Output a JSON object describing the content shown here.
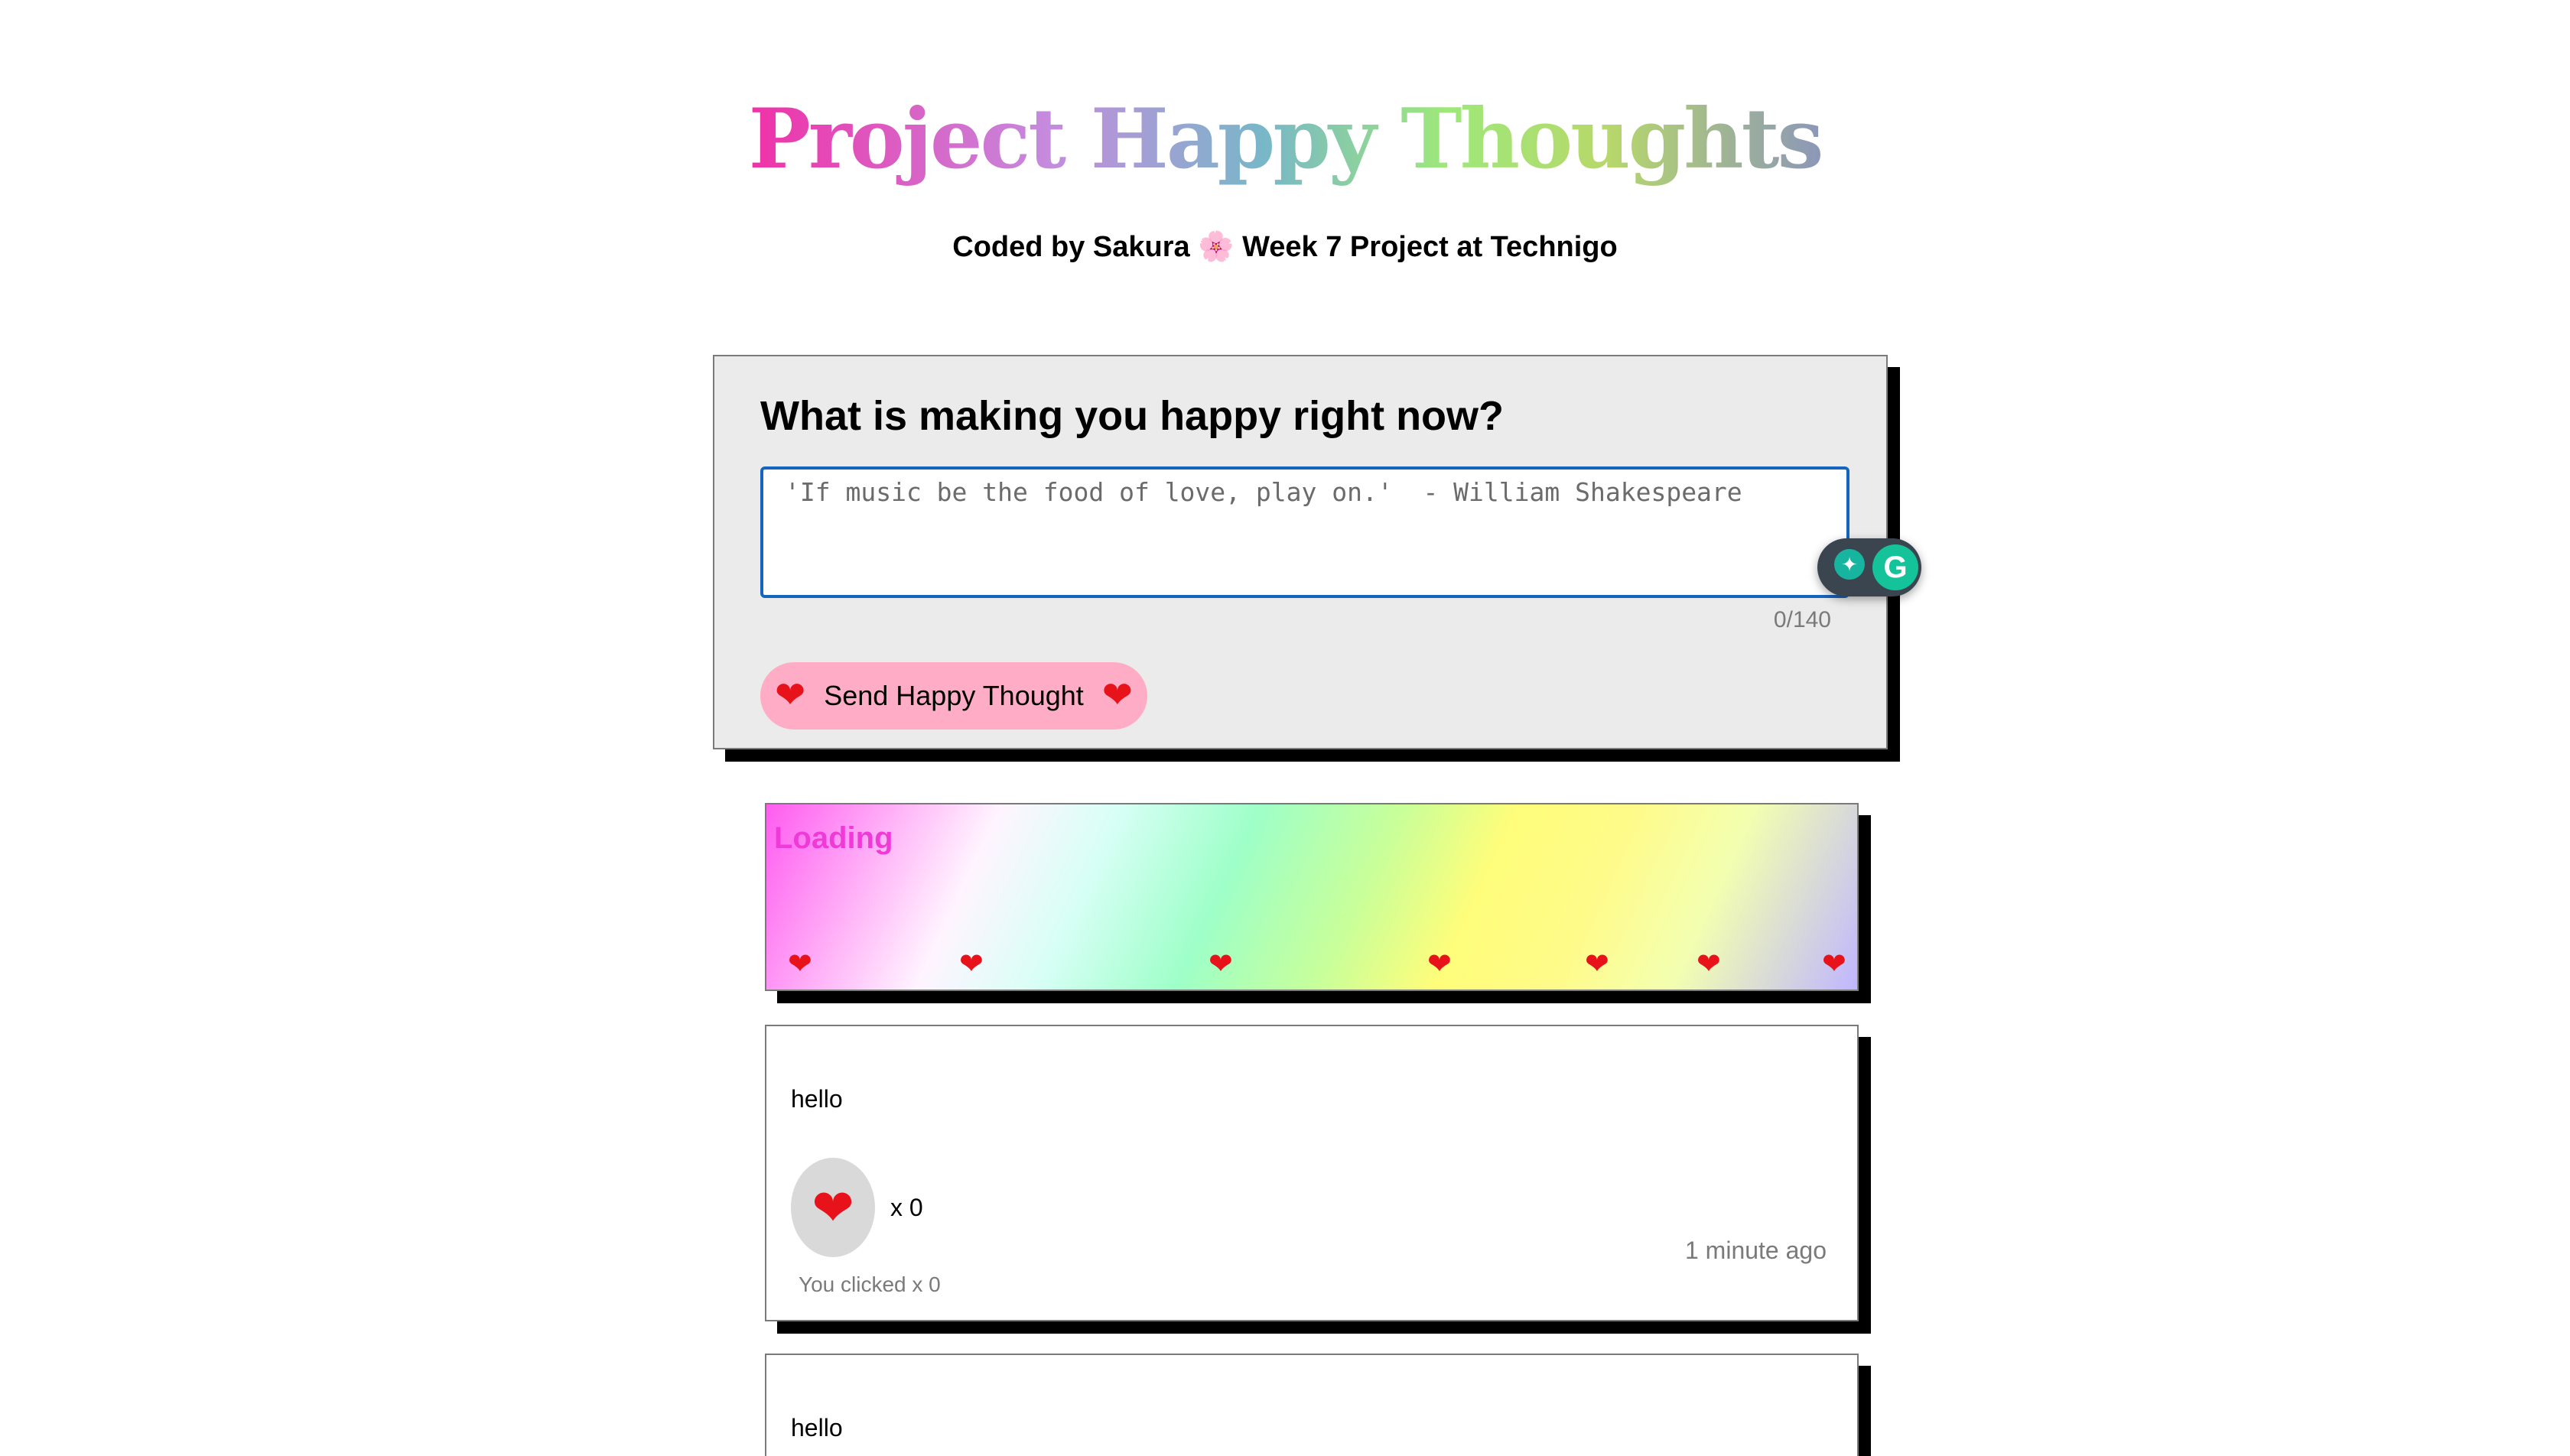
{
  "header": {
    "title": "Project Happy Thoughts",
    "subtitle": "Coded by Sakura 🌸 Week 7 Project at Technigo"
  },
  "form": {
    "question": "What is making you happy right now?",
    "input_value": "",
    "placeholder": "'If music be the food of love, play on.'  - William Shakespeare",
    "char_count": "0/140",
    "send_button_label": "Send Happy Thought",
    "send_icon": "heart-icon"
  },
  "grammarly": {
    "spark_icon": "sparkle-icon",
    "logo_letter": "G"
  },
  "loading": {
    "label": "Loading",
    "heart_count": 7,
    "heart_icon": "heart-icon"
  },
  "thoughts": [
    {
      "message": "hello",
      "like_count": "x 0",
      "time_ago": "1 minute ago",
      "you_clicked": "You clicked x 0"
    },
    {
      "message": "hello"
    }
  ],
  "colors": {
    "send_button": "#ffadc6",
    "form_background": "#ebebeb",
    "input_border": "#1565c0",
    "loading_text": "#f03ad8",
    "heart": "#e8121a"
  }
}
